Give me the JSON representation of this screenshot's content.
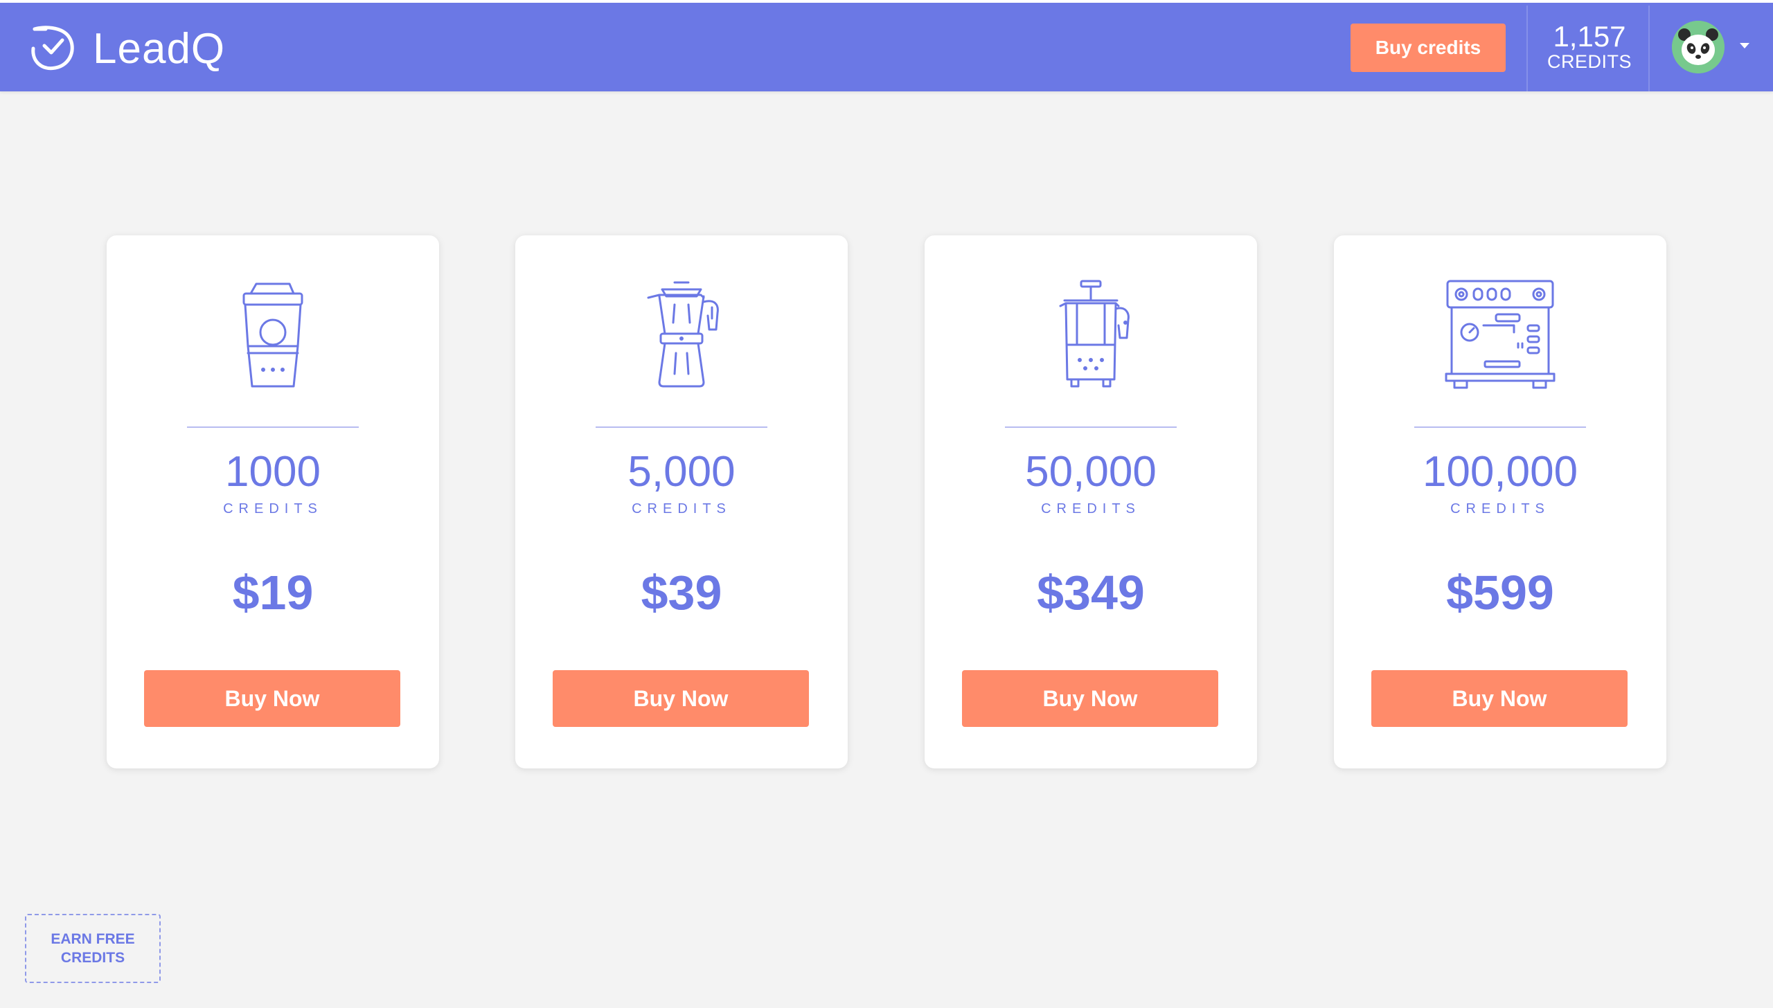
{
  "header": {
    "brand": "LeadQ",
    "buy_credits_label": "Buy credits",
    "credits_count": "1,157",
    "credits_label": "CREDITS",
    "logo_icon": "clock-check-icon",
    "avatar_icon": "panda-avatar",
    "dropdown_icon": "caret-down-icon"
  },
  "packages": [
    {
      "icon": "coffee-cup-icon",
      "amount": "1000",
      "unit": "CREDITS",
      "price": "$19",
      "button": "Buy Now"
    },
    {
      "icon": "moka-pot-icon",
      "amount": "5,000",
      "unit": "CREDITS",
      "price": "$39",
      "button": "Buy Now"
    },
    {
      "icon": "french-press-icon",
      "amount": "50,000",
      "unit": "CREDITS",
      "price": "$349",
      "button": "Buy Now"
    },
    {
      "icon": "espresso-machine-icon",
      "amount": "100,000",
      "unit": "CREDITS",
      "price": "$599",
      "button": "Buy Now"
    }
  ],
  "earn_free_label": "EARN FREE CREDITS",
  "colors": {
    "primary": "#6b78e5",
    "accent": "#ff8b6a",
    "background": "#f3f3f3",
    "card": "#ffffff"
  }
}
